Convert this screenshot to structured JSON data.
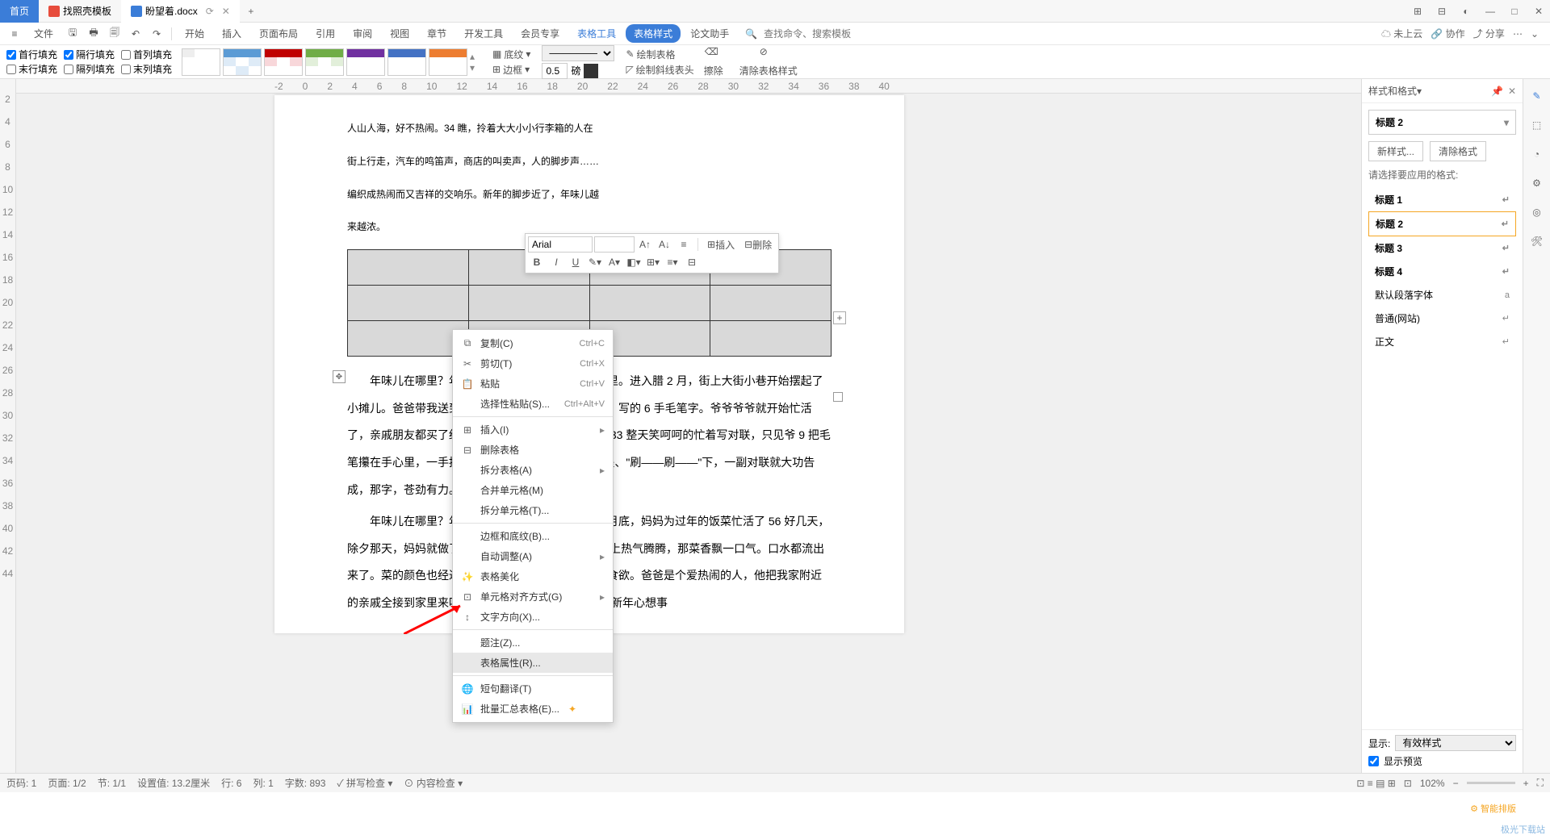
{
  "tabs": {
    "home": "首页",
    "t1": "找照壳模板",
    "t2": "盼望着.docx",
    "add": "+"
  },
  "win": {
    "grid": "⊞",
    "apps": "⊟",
    "user": "◐",
    "min": "—",
    "max": "□",
    "close": "✕"
  },
  "menubar": {
    "file": "文件",
    "items": [
      "开始",
      "插入",
      "页面布局",
      "引用",
      "审阅",
      "视图",
      "章节",
      "开发工具",
      "会员专享",
      "表格工具",
      "表格样式",
      "论文助手"
    ],
    "search_icon": "🔍",
    "search_ph": "查找命令、搜索模板"
  },
  "right_tools": {
    "cloud": "☁ 未上云",
    "coop": "🔗 协作",
    "share": "⤴ 分享",
    "more": "⋯",
    "down": "⌄"
  },
  "ribbon": {
    "fills": {
      "r1": [
        "首行填充",
        "隔行填充",
        "首列填充"
      ],
      "r2": [
        "末行填充",
        "隔列填充",
        "末列填充"
      ]
    },
    "shading": "底纹",
    "border": "边框",
    "pen_w": "0.5",
    "pen_u": "磅",
    "draw": "绘制表格",
    "diag": "绘制斜线表头",
    "erase": "擦除",
    "clear": "清除表格样式"
  },
  "ruler_h": [
    "-2",
    "0",
    "2",
    "4",
    "6",
    "8",
    "10",
    "12",
    "14",
    "16",
    "18",
    "20",
    "22",
    "24",
    "26",
    "28",
    "30",
    "32",
    "34",
    "36",
    "38",
    "40"
  ],
  "ruler_v": [
    "",
    "2",
    "4",
    "6",
    "8",
    "10",
    "12",
    "14",
    "16",
    "18",
    "20",
    "22",
    "24",
    "26",
    "28",
    "30",
    "32",
    "34",
    "36",
    "38",
    "40",
    "42",
    "44"
  ],
  "doc": {
    "p1a": "人山人海，好不热闹。34 瞧，拎着大大小小行李箱的人在",
    "p1b": "街上行走，汽车的鸣笛声，商店的叫卖声，人的脚步声……",
    "p1c": "编织成热闹而又吉祥的交响乐。新年的脚步近了，年味儿越",
    "p1d": "来越浓。",
    "p2": "年味儿在哪里？年味儿在那散发着油墨清的对联里。进入腊 2 月，街上大街小巷开始摆起了小摊儿。爸爸带我送到爷爷家。爷爷曾经是语文老师，写的 6 手毛笔字。爷爷爷爷就开始忙活了，亲戚朋友都买了红纸拿到爷爷家，让爷爷写对联 33 整天笑呵呵的忙着写对联，只见爷 9 把毛笔攥在手心里，一手按纸，一 54 手有力的握笔、蘸墨、\"刷——刷——\"下，一副对联就大功告成，那字，苍劲有力。",
    "p3": "年味儿在哪里？年味儿在妈妈忙碌的身影里。腊月底，妈妈为过年的饭菜忙活了 56 好几天，除夕那天，妈妈就做了满满 342 一桌子团年饭，饭桌上热气腾腾，那菜香飘一口气。口水都流出来了。菜的颜色也经过妈妈细心搭配，让人看了就有食欲。爸爸是个爱热闹的人，他把我家附近的亲戚全接到家里来吃团年饭，\"表叔，我敬您，祝您新年心想事"
  },
  "mini": {
    "font": "Arial",
    "size": "",
    "insert": "插入",
    "delete": "删除"
  },
  "ctx": {
    "copy": "复制(C)",
    "copy_k": "Ctrl+C",
    "cut": "剪切(T)",
    "cut_k": "Ctrl+X",
    "paste": "粘贴",
    "paste_k": "Ctrl+V",
    "pastesp": "选择性粘贴(S)...",
    "pastesp_k": "Ctrl+Alt+V",
    "insert": "插入(I)",
    "deltable": "删除表格",
    "split_t": "拆分表格(A)",
    "merge": "合并单元格(M)",
    "split_c": "拆分单元格(T)...",
    "border": "边框和底纹(B)...",
    "autofit": "自动调整(A)",
    "beautify": "表格美化",
    "align": "单元格对齐方式(G)",
    "textdir": "文字方向(X)...",
    "caption": "题注(Z)...",
    "props": "表格属性(R)...",
    "trans": "短句翻译(T)",
    "batch": "批量汇总表格(E)..."
  },
  "panel": {
    "title": "样式和格式",
    "current": "标题 2",
    "new": "新样式...",
    "clear": "清除格式",
    "prompt": "请选择要应用的格式:",
    "styles": [
      "标题 1",
      "标题 2",
      "标题 3",
      "标题 4",
      "默认段落字体",
      "普通(网站)",
      "正文"
    ],
    "show": "显示:",
    "show_v": "有效样式",
    "preview": "显示预览"
  },
  "status": {
    "page": "页码: 1",
    "pages": "页面: 1/2",
    "section": "节: 1/1",
    "set": "设置值: 13.2厘米",
    "line": "行: 6",
    "col": "列: 1",
    "words": "字数: 893",
    "spell": "拼写检查",
    "content": "内容检查",
    "zoom": "102%",
    "smart": "⚙ 智能排版",
    "wm": "极光下载站"
  }
}
